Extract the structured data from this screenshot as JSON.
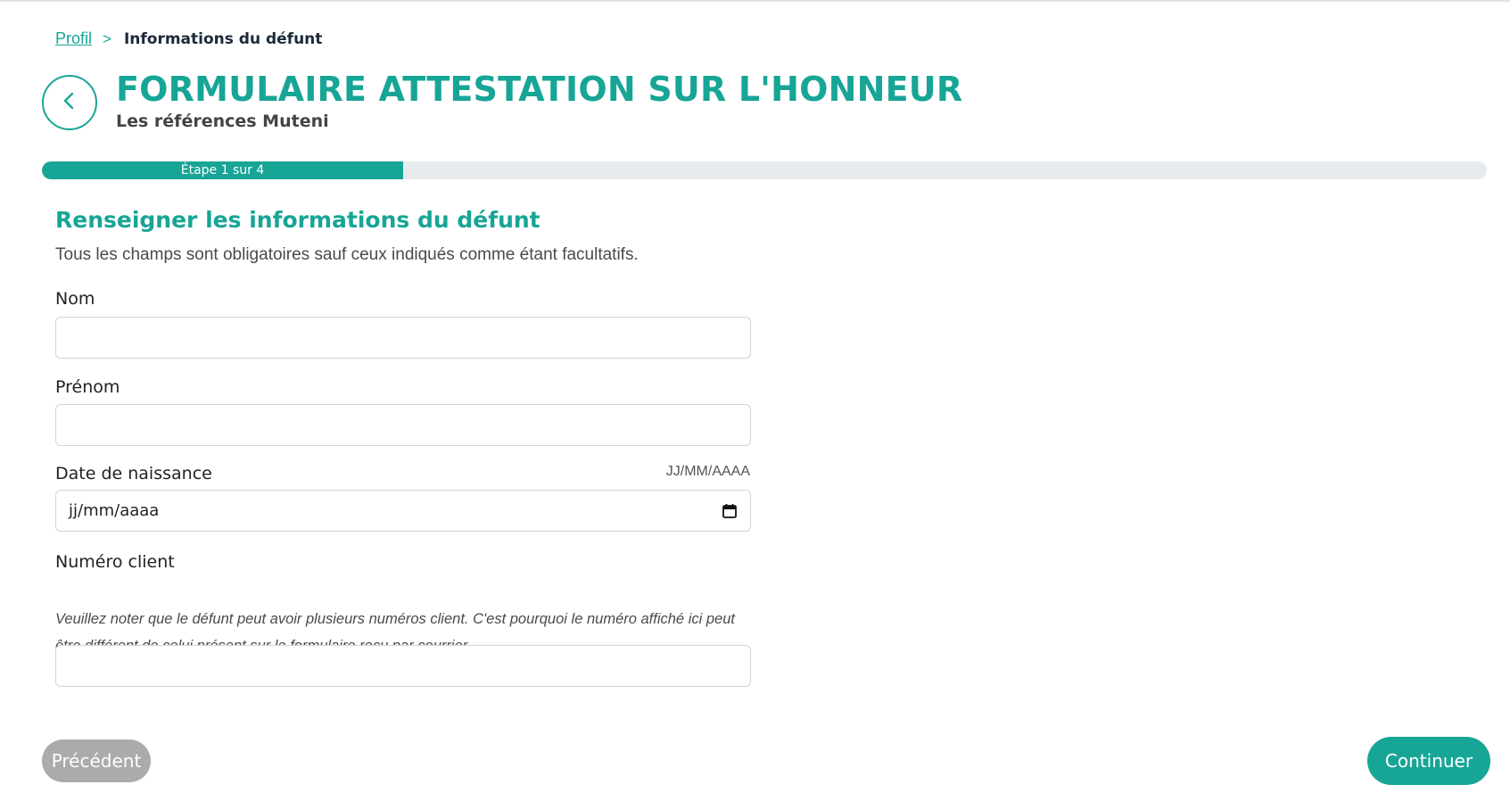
{
  "breadcrumb": {
    "parent": "Profil",
    "separator": ">",
    "current": "Informations du défunt"
  },
  "header": {
    "back_icon": "chevron-left-icon",
    "title": "FORMULAIRE ATTESTATION SUR L'HONNEUR",
    "subtitle": "Les références Muteni"
  },
  "progress": {
    "label": "Étape 1 sur 4",
    "fraction": 0.25
  },
  "section": {
    "title": "Renseigner les informations du défunt",
    "description": "Tous les champs sont obligatoires sauf ceux indiqués comme étant facultatifs."
  },
  "form": {
    "nom": {
      "label": "Nom",
      "value": ""
    },
    "prenom": {
      "label": "Prénom",
      "value": ""
    },
    "date_naissance": {
      "label": "Date de naissance",
      "format_hint": "JJ/MM/AAAA",
      "placeholder": "jj/mm/aaaa",
      "icon": "calendar-icon"
    },
    "numero_client": {
      "label": "Numéro client",
      "note": "Veuillez noter que le défunt peut avoir plusieurs numéros client. C'est pourquoi le numéro affiché ici peut être différent de celui présent sur le formulaire reçu par courrier.",
      "value": ""
    }
  },
  "actions": {
    "previous": "Précédent",
    "continue": "Continuer"
  },
  "colors": {
    "accent": "#17a596",
    "disabled_button": "#a9abad",
    "track": "#e8ebee"
  }
}
